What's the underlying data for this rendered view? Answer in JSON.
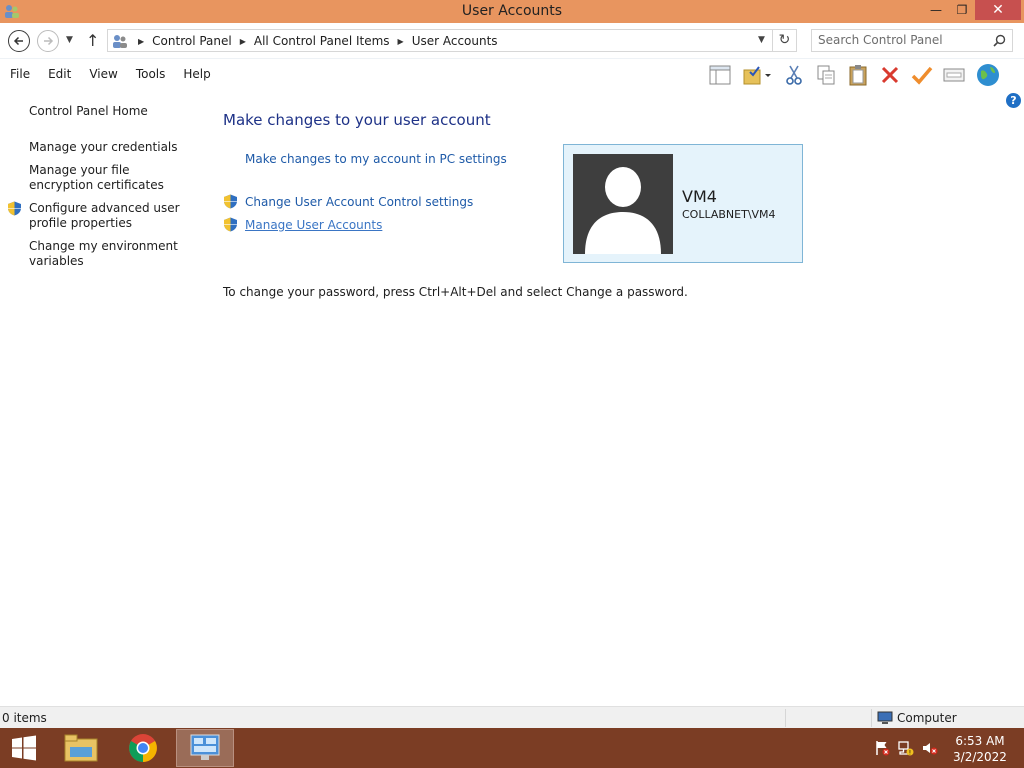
{
  "window": {
    "title": "User Accounts",
    "minimize_glyph": "—",
    "maximize_glyph": "❐",
    "close_glyph": "✕"
  },
  "address": {
    "breadcrumbs": [
      "Control Panel",
      "All Control Panel Items",
      "User Accounts"
    ],
    "search_placeholder": "Search Control Panel"
  },
  "menu": [
    "File",
    "Edit",
    "View",
    "Tools",
    "Help"
  ],
  "toolbar_icons": [
    "layout-icon",
    "folder-check-icon",
    "cut-icon",
    "copy-icon",
    "paste-icon",
    "delete-icon",
    "check-icon",
    "properties-icon",
    "globe-icon"
  ],
  "sidebar": {
    "home": "Control Panel Home",
    "items": [
      "Manage your credentials",
      "Manage your file encryption certificates",
      "Configure advanced user profile properties",
      "Change my environment variables"
    ]
  },
  "main": {
    "title": "Make changes to your user account",
    "pc_settings_link": "Make changes to my account in PC settings",
    "uac_link": "Change User Account Control settings",
    "manage_link": "Manage User Accounts",
    "password_note": "To change your password, press Ctrl+Alt+Del and select Change a password."
  },
  "account": {
    "name": "VM4",
    "domain": "COLLABNET\\VM4"
  },
  "status": {
    "items": "0 items",
    "location": "Computer"
  },
  "taskbar": {
    "time": "6:53 AM",
    "date": "3/2/2022"
  },
  "colors": {
    "titlebar": "#e8955f",
    "close_button": "#c7504f",
    "taskbar": "#7b3d24",
    "link": "#1e5aa8",
    "heading": "#1e3287",
    "card_bg": "#e5f3fb",
    "card_border": "#7fb5d6"
  }
}
